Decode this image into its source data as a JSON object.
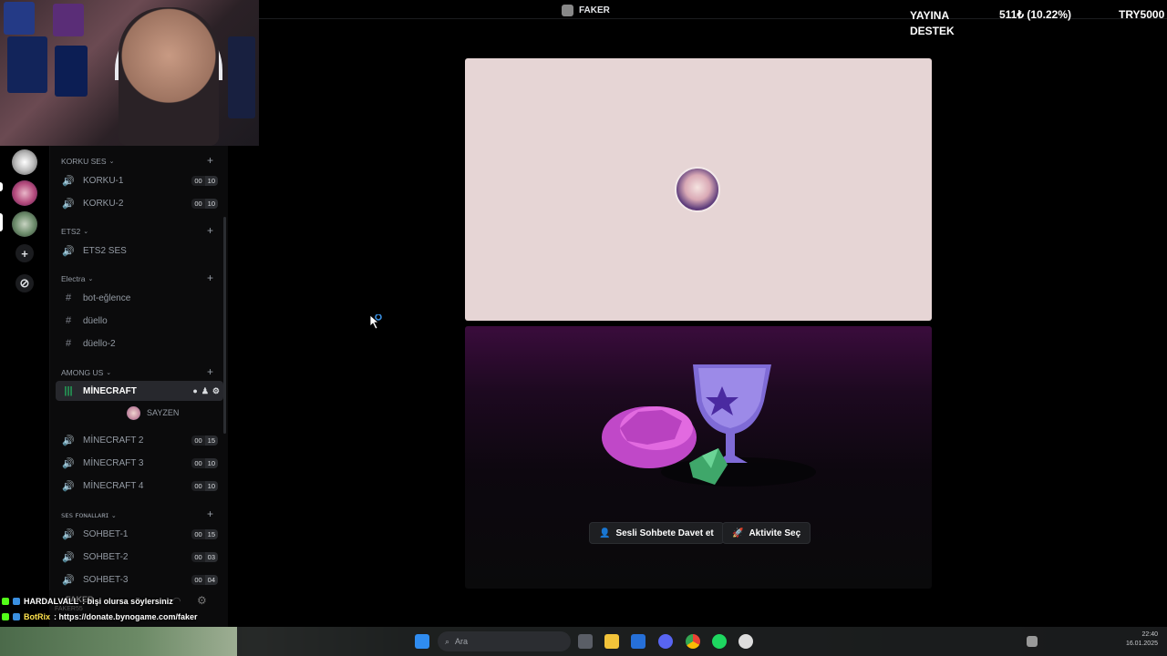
{
  "topbar": {
    "server_name": "FAKER"
  },
  "overlay": {
    "support_label": "YAYINA\nDESTEK",
    "amount": "511₺ (10.22%)",
    "goal": "TRY5000"
  },
  "sidebar": {
    "categories": [
      {
        "name": "KORKU SES",
        "channels": [
          {
            "name": "KORKU-1",
            "type": "voice",
            "count": "00",
            "limit": "10"
          },
          {
            "name": "KORKU-2",
            "type": "voice",
            "count": "00",
            "limit": "10"
          }
        ]
      },
      {
        "name": "ETS2",
        "channels": [
          {
            "name": "ETS2 SES",
            "type": "voice"
          }
        ]
      },
      {
        "name": "Electra",
        "channels": [
          {
            "name": "bot-eğlence",
            "type": "text"
          },
          {
            "name": "düello",
            "type": "text"
          },
          {
            "name": "düello-2",
            "type": "text"
          }
        ]
      },
      {
        "name": "AMONG US",
        "channels": [
          {
            "name": "MİNECRAFT",
            "type": "voice-active"
          },
          {
            "name": "MİNECRAFT 2",
            "type": "voice",
            "count": "00",
            "limit": "15"
          },
          {
            "name": "MİNECRAFT 3",
            "type": "voice",
            "count": "00",
            "limit": "10"
          },
          {
            "name": "MİNECRAFT 4",
            "type": "voice",
            "count": "00",
            "limit": "10"
          }
        ]
      },
      {
        "name": "ꜱᴇꜱ ꜰᴏɴᴀʟʟᴀʀɪ",
        "channels": [
          {
            "name": "SOHBET-1",
            "type": "voice",
            "count": "00",
            "limit": "15"
          },
          {
            "name": "SOHBET-2",
            "type": "voice",
            "count": "00",
            "limit": "03"
          },
          {
            "name": "SOHBET-3",
            "type": "voice",
            "count": "00",
            "limit": "04"
          }
        ]
      }
    ],
    "active_member": "SAYZEN",
    "user_panel_name": "FAKER",
    "user_panel_sub": "FAKER55"
  },
  "stage": {
    "invite_label": "Sesli Sohbete Davet et",
    "activity_label": "Aktivite Seç"
  },
  "chat": [
    {
      "user": "HARDALVALL",
      "message": ": bişi olursa söylersiniz"
    },
    {
      "user": "BotRix",
      "message": ": https://donate.bynogame.com/faker"
    }
  ],
  "taskbar": {
    "search_placeholder": "Ara",
    "time": "22:40",
    "date": "16.01.2025"
  },
  "colors": {
    "active_voice": "#23a55a",
    "stage_top": "#e6d5d5",
    "accent": "#5865f2"
  }
}
